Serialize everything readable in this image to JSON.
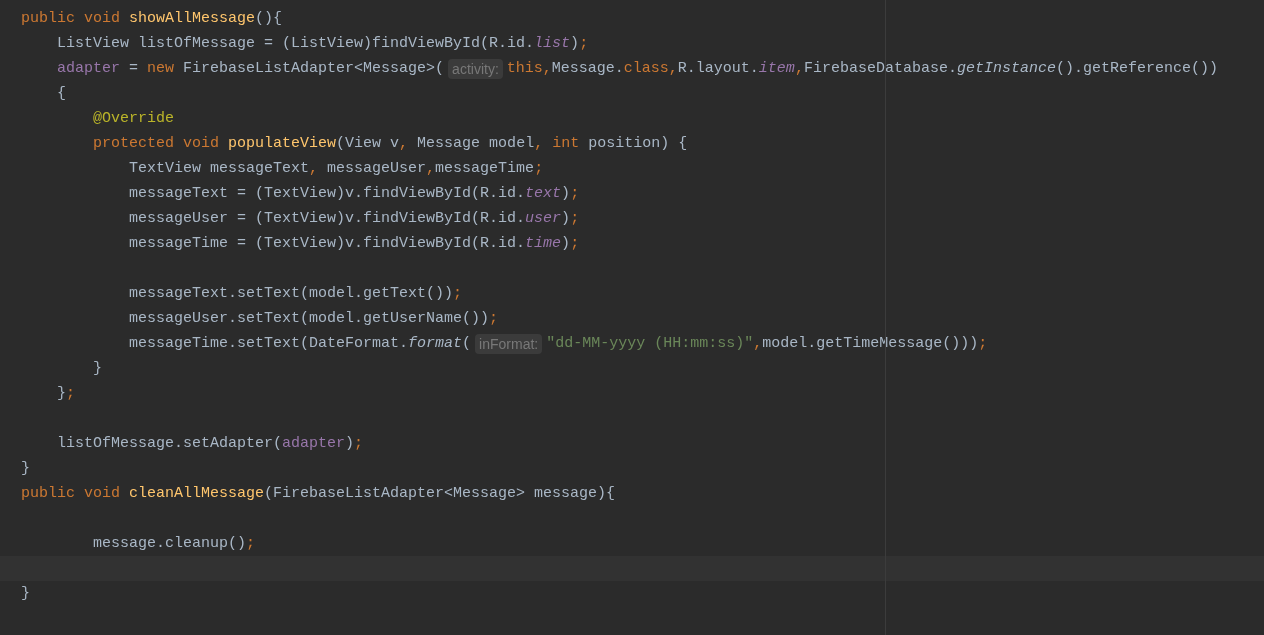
{
  "editor": {
    "lines": [
      {
        "tokens": [
          {
            "kind": "keyword",
            "text": "public void "
          },
          {
            "kind": "method",
            "text": "showAllMessage"
          },
          {
            "kind": "plain",
            "text": "(){"
          }
        ]
      },
      {
        "tokens": [
          {
            "kind": "plain",
            "text": "    ListView listOfMessage = (ListView)findViewById(R.id."
          },
          {
            "kind": "fielditalic",
            "text": "list"
          },
          {
            "kind": "plain",
            "text": ")"
          },
          {
            "kind": "keyword",
            "text": ";"
          }
        ]
      },
      {
        "tokens": [
          {
            "kind": "field",
            "text": "    adapter"
          },
          {
            "kind": "plain",
            "text": " = "
          },
          {
            "kind": "keyword",
            "text": "new "
          },
          {
            "kind": "plain",
            "text": "FirebaseListAdapter<Message>("
          },
          {
            "kind": "hint",
            "text": "activity:"
          },
          {
            "kind": "keyword",
            "text": "this,"
          },
          {
            "kind": "plain",
            "text": "Message."
          },
          {
            "kind": "keyword",
            "text": "class,"
          },
          {
            "kind": "plain",
            "text": "R.layout."
          },
          {
            "kind": "fielditalic",
            "text": "item"
          },
          {
            "kind": "keyword",
            "text": ","
          },
          {
            "kind": "plain",
            "text": "FirebaseDatabase."
          },
          {
            "kind": "staticitalic",
            "text": "getInstance"
          },
          {
            "kind": "plain",
            "text": "().getReference())"
          }
        ]
      },
      {
        "tokens": [
          {
            "kind": "plain",
            "text": "    {"
          }
        ]
      },
      {
        "tokens": [
          {
            "kind": "annotation",
            "text": "        @Override"
          }
        ]
      },
      {
        "tokens": [
          {
            "kind": "keyword",
            "text": "        protected void "
          },
          {
            "kind": "method",
            "text": "populateView"
          },
          {
            "kind": "plain",
            "text": "(View v"
          },
          {
            "kind": "keyword",
            "text": ", "
          },
          {
            "kind": "plain",
            "text": "Message model"
          },
          {
            "kind": "keyword",
            "text": ", int "
          },
          {
            "kind": "plain",
            "text": "position) {"
          }
        ]
      },
      {
        "tokens": [
          {
            "kind": "plain",
            "text": "            TextView messageText"
          },
          {
            "kind": "keyword",
            "text": ", "
          },
          {
            "kind": "plain",
            "text": "messageUser"
          },
          {
            "kind": "keyword",
            "text": ","
          },
          {
            "kind": "plain",
            "text": "messageTime"
          },
          {
            "kind": "keyword",
            "text": ";"
          }
        ]
      },
      {
        "tokens": [
          {
            "kind": "plain",
            "text": "            messageText = (TextView)v.findViewById(R.id."
          },
          {
            "kind": "fielditalic",
            "text": "text"
          },
          {
            "kind": "plain",
            "text": ")"
          },
          {
            "kind": "keyword",
            "text": ";"
          }
        ]
      },
      {
        "tokens": [
          {
            "kind": "plain",
            "text": "            messageUser = (TextView)v.findViewById(R.id."
          },
          {
            "kind": "fielditalic",
            "text": "user"
          },
          {
            "kind": "plain",
            "text": ")"
          },
          {
            "kind": "keyword",
            "text": ";"
          }
        ]
      },
      {
        "tokens": [
          {
            "kind": "plain",
            "text": "            messageTime = (TextView)v.findViewById(R.id."
          },
          {
            "kind": "fielditalic",
            "text": "time"
          },
          {
            "kind": "plain",
            "text": ")"
          },
          {
            "kind": "keyword",
            "text": ";"
          }
        ]
      },
      {
        "kind": "blank"
      },
      {
        "tokens": [
          {
            "kind": "plain",
            "text": "            messageText.setText(model.getText())"
          },
          {
            "kind": "keyword",
            "text": ";"
          }
        ]
      },
      {
        "tokens": [
          {
            "kind": "plain",
            "text": "            messageUser.setText(model.getUserName())"
          },
          {
            "kind": "keyword",
            "text": ";"
          }
        ]
      },
      {
        "tokens": [
          {
            "kind": "plain",
            "text": "            messageTime.setText(DateFormat."
          },
          {
            "kind": "staticitalic",
            "text": "format"
          },
          {
            "kind": "plain",
            "text": "("
          },
          {
            "kind": "hint",
            "text": "inFormat:"
          },
          {
            "kind": "string",
            "text": "\"dd-MM-yyyy (HH:mm:ss)\""
          },
          {
            "kind": "keyword",
            "text": ","
          },
          {
            "kind": "plain",
            "text": "model.getTimeMessage()))"
          },
          {
            "kind": "keyword",
            "text": ";"
          }
        ]
      },
      {
        "tokens": [
          {
            "kind": "plain",
            "text": "        }"
          }
        ]
      },
      {
        "tokens": [
          {
            "kind": "plain",
            "text": "    }"
          },
          {
            "kind": "keyword",
            "text": ";"
          }
        ]
      },
      {
        "kind": "blank"
      },
      {
        "tokens": [
          {
            "kind": "plain",
            "text": "    listOfMessage.setAdapter("
          },
          {
            "kind": "field",
            "text": "adapter"
          },
          {
            "kind": "plain",
            "text": ")"
          },
          {
            "kind": "keyword",
            "text": ";"
          }
        ]
      },
      {
        "tokens": [
          {
            "kind": "plain",
            "text": "}"
          }
        ]
      },
      {
        "tokens": [
          {
            "kind": "keyword",
            "text": "public void "
          },
          {
            "kind": "method",
            "text": "cleanAllMessage"
          },
          {
            "kind": "plain",
            "text": "(FirebaseListAdapter<Message> message){"
          }
        ]
      },
      {
        "kind": "blank"
      },
      {
        "tokens": [
          {
            "kind": "plain",
            "text": "        message.cleanup()"
          },
          {
            "kind": "keyword",
            "text": ";"
          }
        ]
      },
      {
        "kind": "current-line"
      },
      {
        "tokens": [
          {
            "kind": "plain",
            "text": "}"
          }
        ]
      }
    ]
  }
}
